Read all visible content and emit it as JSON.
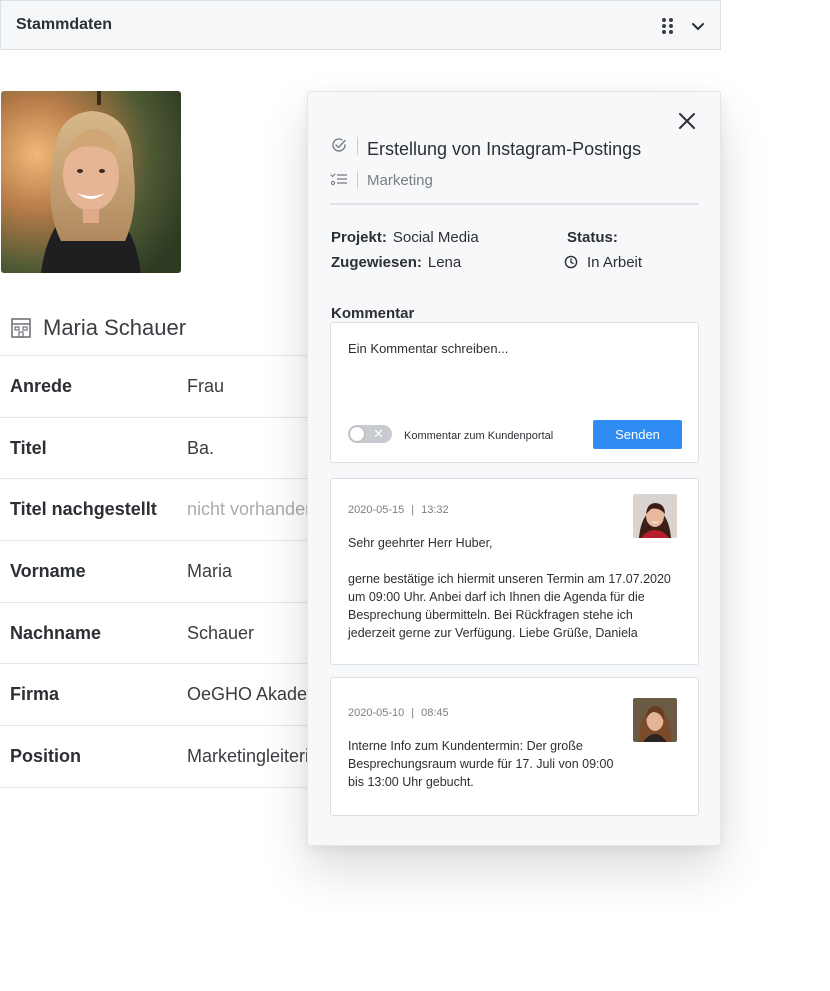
{
  "header": {
    "title": "Stammdaten"
  },
  "contact": {
    "name": "Maria Schauer",
    "fields": [
      {
        "label": "Anrede",
        "value": "Frau"
      },
      {
        "label": "Titel",
        "value": "Ba."
      },
      {
        "label": "Titel nachgestellt",
        "value": "nicht vorhanden"
      },
      {
        "label": "Vorname",
        "value": "Maria"
      },
      {
        "label": "Nachname",
        "value": "Schauer"
      },
      {
        "label": "Firma",
        "value": "OeGHO Akademie"
      },
      {
        "label": "Position",
        "value": "Marketingleiterin"
      }
    ]
  },
  "task": {
    "title": "Erstellung von Instagram-Postings",
    "category": "Marketing",
    "project_label": "Projekt:",
    "project_value": "Social Media",
    "assigned_label": "Zugewiesen:",
    "assigned_value": "Lena",
    "status_label": "Status:",
    "status_value": "In Arbeit",
    "comment_label": "Kommentar",
    "comment_placeholder": "Ein Kommentar schreiben...",
    "toggle_label": "Kommentar zum Kundenportal",
    "send_label": "Senden",
    "comments": [
      {
        "date": "2020-05-15",
        "time": "13:32",
        "greeting": "Sehr geehrter Herr Huber,",
        "body": "gerne bestätige ich hiermit unseren Termin am 17.07.2020 um 09:00 Uhr. Anbei darf ich Ihnen die Agenda für die Besprechung übermitteln. Bei Rückfragen stehe ich jederzeit gerne zur Verfügung. Liebe Grüße, Daniela"
      },
      {
        "date": "2020-05-10",
        "time": "08:45",
        "body": "Interne Info zum Kundentermin: Der große Besprechungsraum wurde für 17. Juli von 09:00 bis 13:00 Uhr gebucht."
      }
    ]
  },
  "colors": {
    "accent": "#2f8cf2",
    "border": "#dcdfe3",
    "panel_bg": "#f7f8f9"
  },
  "icons": [
    "drag-handle-icon",
    "chevron-down-icon",
    "building-icon",
    "close-icon",
    "task-check-icon",
    "category-list-icon",
    "clock-icon"
  ]
}
